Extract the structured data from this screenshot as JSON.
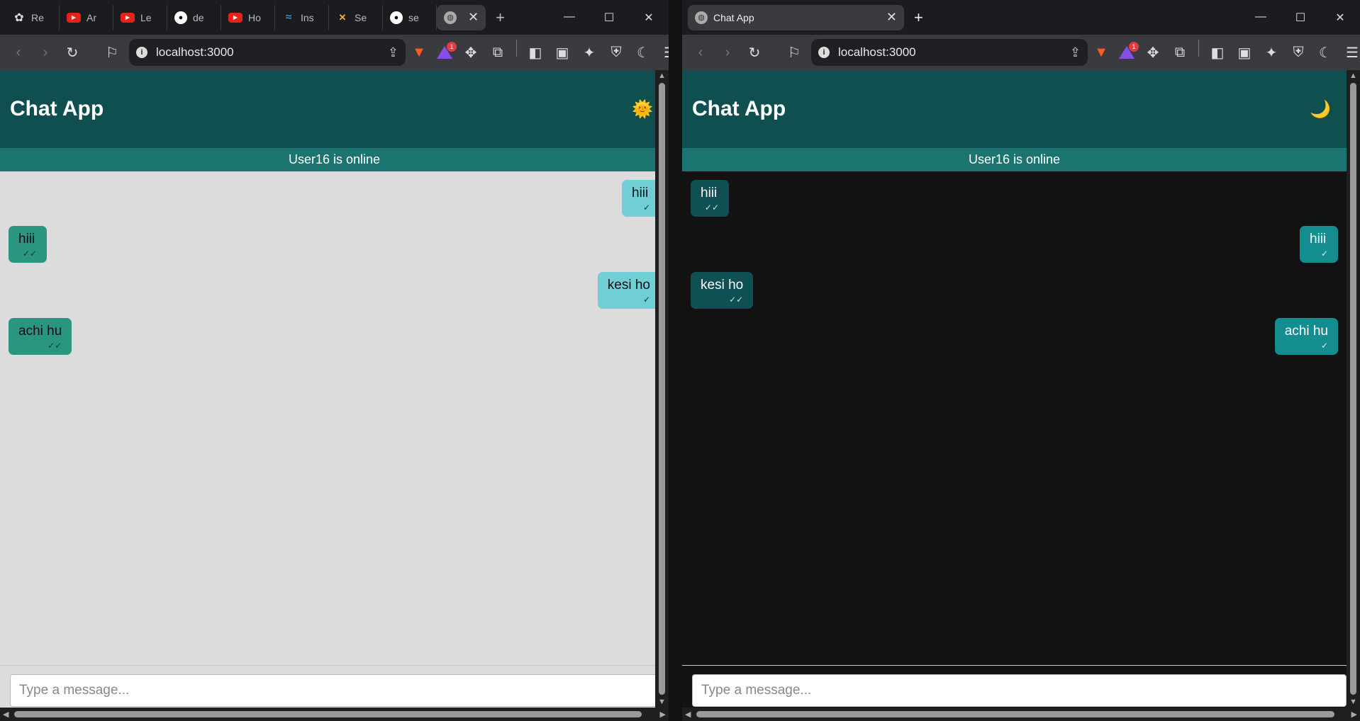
{
  "left_window": {
    "tabs": [
      {
        "label": "Re",
        "icon": "chatgpt-icon"
      },
      {
        "label": "Ar",
        "icon": "youtube-icon"
      },
      {
        "label": "Le",
        "icon": "youtube-icon"
      },
      {
        "label": "de",
        "icon": "github-icon"
      },
      {
        "label": "Ho",
        "icon": "youtube-icon"
      },
      {
        "label": "Ins",
        "icon": "tailwind-icon"
      },
      {
        "label": "Se",
        "icon": "fb-icon"
      },
      {
        "label": "se",
        "icon": "github-icon"
      }
    ],
    "active_tab": {
      "label": "",
      "icon": "globe-icon"
    },
    "url": "localhost:3000",
    "rewards_badge": "1"
  },
  "right_window": {
    "active_tab": {
      "label": "Chat App",
      "icon": "globe-icon"
    },
    "url": "localhost:3000",
    "rewards_badge": "1"
  },
  "left_app": {
    "theme": "light",
    "title": "Chat App",
    "theme_icon": "🌞",
    "status": "User16 is online",
    "messages": [
      {
        "side": "out",
        "text": "hiii",
        "tick": "✓"
      },
      {
        "side": "in",
        "text": "hiii",
        "tick": "✓✓"
      },
      {
        "side": "out",
        "text": "kesi ho",
        "tick": "✓"
      },
      {
        "side": "in",
        "text": "achi hu",
        "tick": "✓✓"
      }
    ],
    "input_placeholder": "Type a message..."
  },
  "right_app": {
    "theme": "dark",
    "title": "Chat App",
    "theme_icon": "🌙",
    "status": "User16 is online",
    "messages": [
      {
        "side": "in",
        "text": "hiii",
        "tick": "✓✓"
      },
      {
        "side": "out",
        "text": "hiii",
        "tick": "✓"
      },
      {
        "side": "in",
        "text": "kesi ho",
        "tick": "✓✓"
      },
      {
        "side": "out",
        "text": "achi hu",
        "tick": "✓"
      }
    ],
    "input_placeholder": "Type a message..."
  },
  "colors": {
    "header": "#0f4f4f",
    "status_bar": "#1c7470",
    "light_bg": "#dcdcdc",
    "dark_bg": "#121212"
  }
}
